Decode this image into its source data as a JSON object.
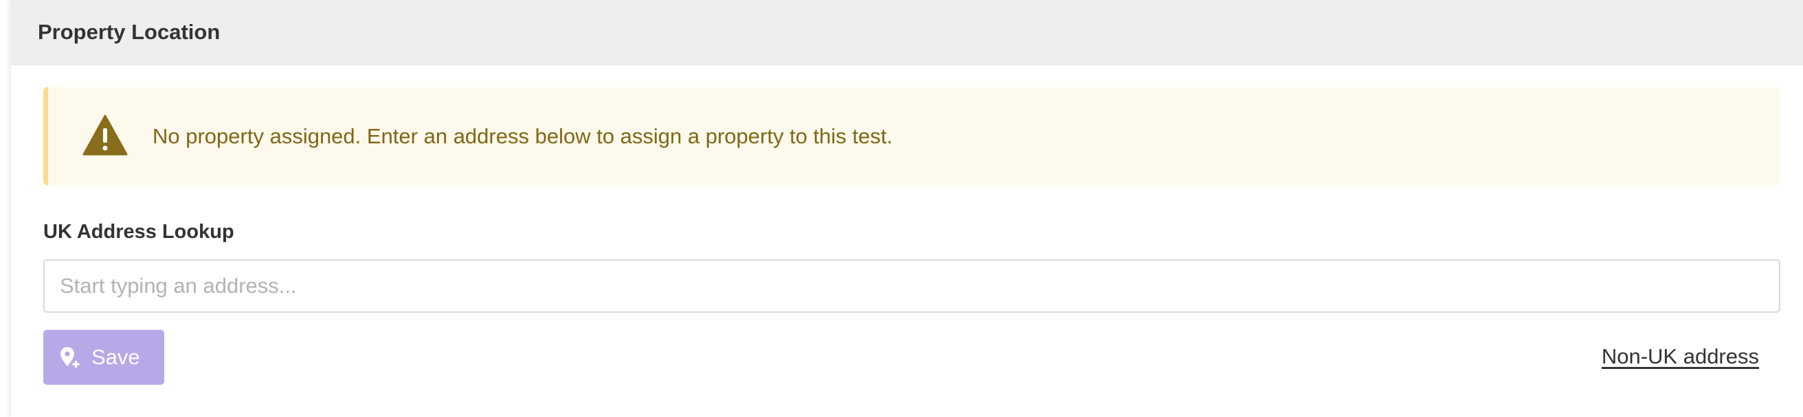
{
  "panel": {
    "title": "Property Location"
  },
  "alert": {
    "icon": "warning-icon",
    "message": "No property assigned. Enter an address below to assign a property to this test.",
    "background_color": "#fdf9ec",
    "border_color": "#f8dd8c",
    "text_color": "#7f6715"
  },
  "address_lookup": {
    "label": "UK Address Lookup",
    "value": "",
    "placeholder": "Start typing an address..."
  },
  "actions": {
    "save_label": "Save",
    "save_icon": "map-pin-plus-icon",
    "save_color": "#b8a8e8",
    "non_uk_label": "Non-UK address"
  }
}
